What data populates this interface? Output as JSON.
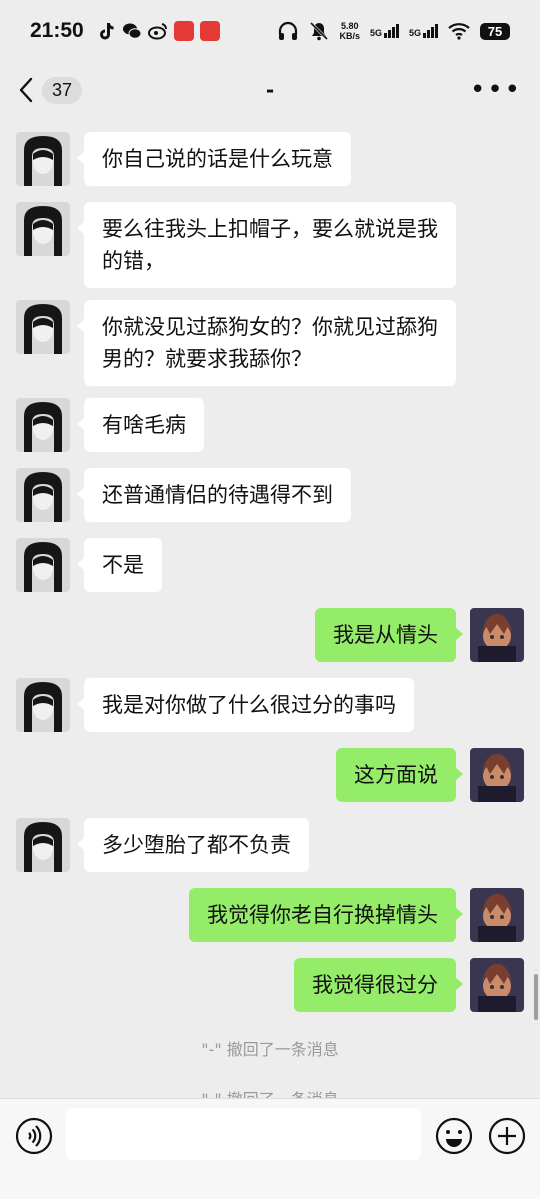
{
  "status_bar": {
    "time": "21:50",
    "net_speed": "5.80",
    "net_unit": "KB/s",
    "sim1": "5G",
    "sim2": "5G",
    "battery": "75",
    "icons": [
      "tiktok-icon",
      "wechat-icon",
      "weibo-icon",
      "app-red-icon",
      "app-red2-icon",
      "headphones-icon",
      "mute-icon",
      "signal-icon",
      "wifi-icon",
      "battery-icon"
    ]
  },
  "header": {
    "unread_count": "37",
    "title": "-"
  },
  "messages": [
    {
      "side": "left",
      "text": "你自己说的话是什么玩意"
    },
    {
      "side": "left",
      "text": "要么往我头上扣帽子，要么就说是我的错，"
    },
    {
      "side": "left",
      "text": "你就没见过舔狗女的？你就见过舔狗男的？就要求我舔你？"
    },
    {
      "side": "left",
      "text": "有啥毛病"
    },
    {
      "side": "left",
      "text": "还普通情侣的待遇得不到"
    },
    {
      "side": "left",
      "text": "不是"
    },
    {
      "side": "right",
      "text": "我是从情头"
    },
    {
      "side": "left",
      "text": "我是对你做了什么很过分的事吗"
    },
    {
      "side": "right",
      "text": "这方面说"
    },
    {
      "side": "left",
      "text": "多少堕胎了都不负责"
    },
    {
      "side": "right",
      "text": "我觉得你老自行换掉情头"
    },
    {
      "side": "right",
      "text": "我觉得很过分"
    }
  ],
  "system_messages": [
    {
      "text": "\"-\" 撤回了一条消息"
    },
    {
      "text": "\"-\" 撤回了一条消息"
    }
  ],
  "input": {
    "placeholder": ""
  },
  "colors": {
    "background": "#ededed",
    "bubble_self": "#95ec69",
    "bubble_other": "#ffffff"
  }
}
